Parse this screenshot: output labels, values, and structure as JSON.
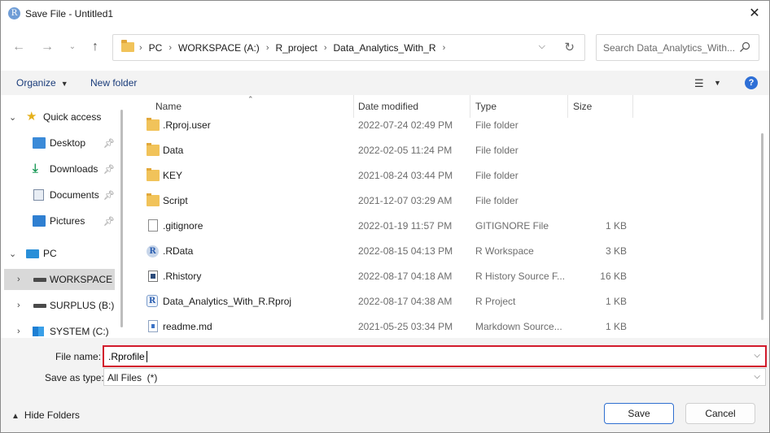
{
  "window": {
    "title": "Save File - Untitled1",
    "app_icon": "R"
  },
  "address": {
    "crumbs": [
      "PC",
      "WORKSPACE (A:)",
      "R_project",
      "Data_Analytics_With_R"
    ]
  },
  "search": {
    "placeholder": "Search Data_Analytics_With..."
  },
  "toolbar": {
    "organize_label": "Organize",
    "new_folder_label": "New folder",
    "help_label": "?"
  },
  "nav": {
    "quick_access": "Quick access",
    "quick_items": [
      "Desktop",
      "Downloads",
      "Documents",
      "Pictures"
    ],
    "pc": "PC",
    "drives": [
      "WORKSPACE (A:)",
      "SURPLUS (B:)",
      "SYSTEM (C:)"
    ]
  },
  "columns": {
    "name": "Name",
    "date": "Date modified",
    "type": "Type",
    "size": "Size"
  },
  "files": [
    {
      "name": ".Rproj.user",
      "date": "2022-07-24 02:49 PM",
      "type": "File folder",
      "size": "",
      "icon": "folder"
    },
    {
      "name": "Data",
      "date": "2022-02-05 11:24 PM",
      "type": "File folder",
      "size": "",
      "icon": "folder"
    },
    {
      "name": "KEY",
      "date": "2021-08-24 03:44 PM",
      "type": "File folder",
      "size": "",
      "icon": "folder"
    },
    {
      "name": "Script",
      "date": "2021-12-07 03:29 AM",
      "type": "File folder",
      "size": "",
      "icon": "folder"
    },
    {
      "name": ".gitignore",
      "date": "2022-01-19 11:57 PM",
      "type": "GITIGNORE File",
      "size": "1 KB",
      "icon": "doc"
    },
    {
      "name": ".RData",
      "date": "2022-08-15 04:13 PM",
      "type": "R Workspace",
      "size": "3 KB",
      "icon": "rws"
    },
    {
      "name": ".Rhistory",
      "date": "2022-08-17 04:18 AM",
      "type": "R History Source F...",
      "size": "16 KB",
      "icon": "rhist"
    },
    {
      "name": "Data_Analytics_With_R.Rproj",
      "date": "2022-08-17 04:38 AM",
      "type": "R Project",
      "size": "1 KB",
      "icon": "rproj"
    },
    {
      "name": "readme.md",
      "date": "2021-05-25 03:34 PM",
      "type": "Markdown Source...",
      "size": "1 KB",
      "icon": "md"
    }
  ],
  "form": {
    "file_name_label": "File name:",
    "file_name_value": ".Rprofile",
    "save_type_label": "Save as type:",
    "save_type_value": "All Files  (*)"
  },
  "footer": {
    "hide_folders": "Hide Folders",
    "save": "Save",
    "cancel": "Cancel"
  },
  "colors": {
    "highlight_border": "#d21a2c",
    "link": "#1a3c7a",
    "help": "#2e6fd6"
  }
}
